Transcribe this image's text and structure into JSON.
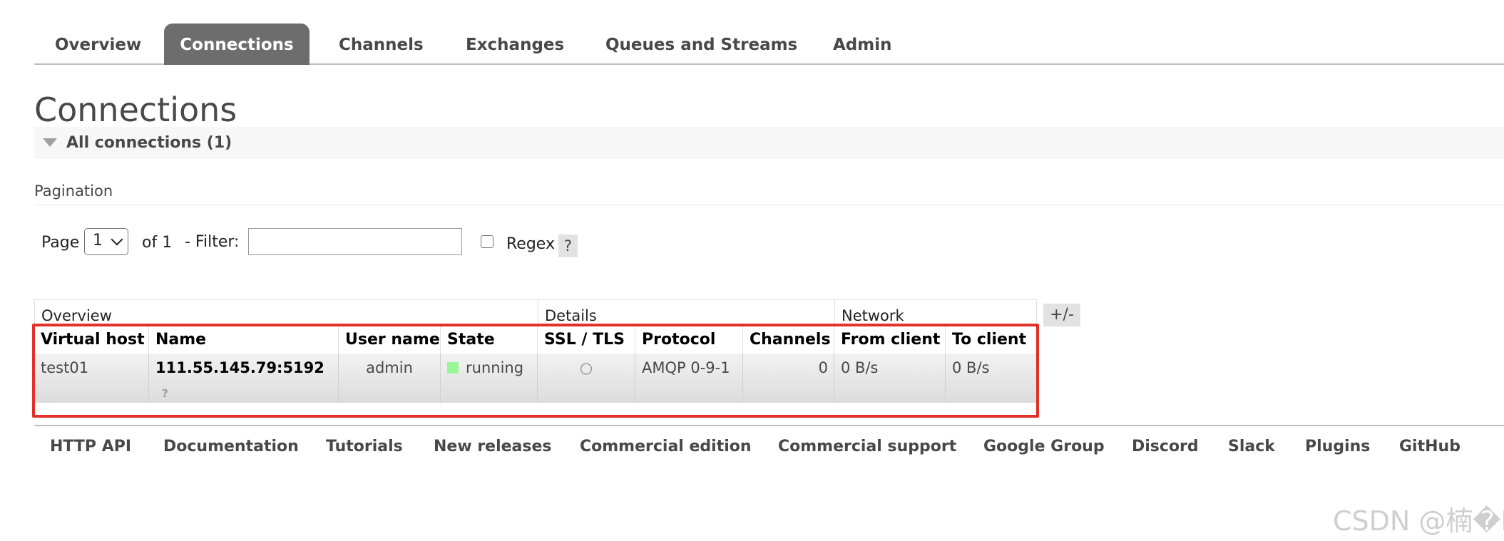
{
  "tabs": [
    {
      "label": "Overview"
    },
    {
      "label": "Connections"
    },
    {
      "label": "Channels"
    },
    {
      "label": "Exchanges"
    },
    {
      "label": "Queues and Streams"
    },
    {
      "label": "Admin"
    }
  ],
  "active_tab": "Connections",
  "page_title": "Connections",
  "section": {
    "title": "All connections (1)",
    "expanded": true
  },
  "pagination": {
    "label": "Pagination",
    "page_label": "Page",
    "page_value": "1",
    "of_label": "of 1",
    "filter_label": "- Filter:",
    "filter_value": "",
    "regex_label": "Regex",
    "regex_checked": false,
    "help_label": "?"
  },
  "table": {
    "groups": [
      "Overview",
      "Details",
      "Network"
    ],
    "toggle_label": "+/-",
    "columns": [
      "Virtual host",
      "Name",
      "User name",
      "State",
      "SSL / TLS",
      "Protocol",
      "Channels",
      "From client",
      "To client"
    ],
    "rows": [
      {
        "virtual_host": "test01",
        "name": "111.55.145.79:5192",
        "name_sub": "?",
        "user_name": "admin",
        "state": "running",
        "ssl_tls": "○",
        "protocol": "AMQP 0-9-1",
        "channels": "0",
        "from_client": "0 B/s",
        "to_client": "0 B/s"
      }
    ]
  },
  "footer_links": [
    "HTTP API",
    "Documentation",
    "Tutorials",
    "New releases",
    "Commercial edition",
    "Commercial support",
    "Google Group",
    "Discord",
    "Slack",
    "Plugins",
    "GitHub"
  ],
  "watermark": "CSDN @楠�David",
  "colors": {
    "active_tab_bg": "#6d6d6d",
    "state_running": "#98f898",
    "highlight_border": "#e2312a"
  }
}
